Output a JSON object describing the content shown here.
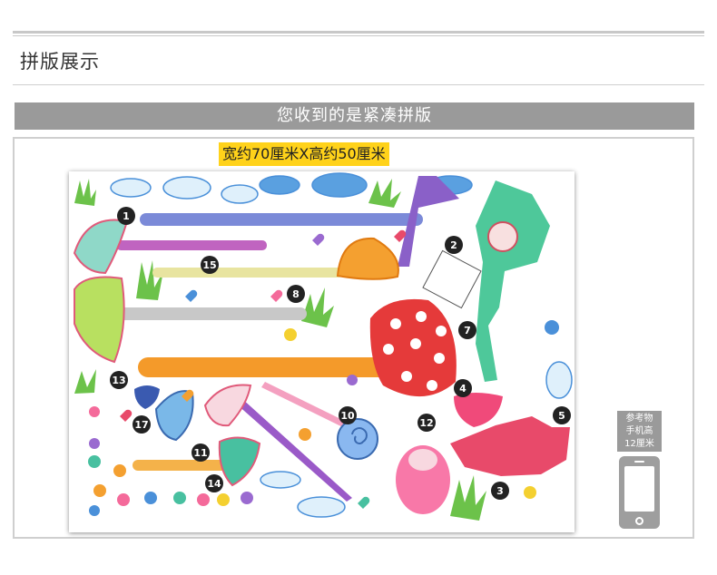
{
  "section": {
    "title": "拼版展示"
  },
  "banner": {
    "text": "您收到的是紧凑拼版"
  },
  "size": {
    "label": "宽约70厘米X高约50厘米"
  },
  "reference": {
    "line1": "参考物",
    "line2": "手机高",
    "line3": "12厘米",
    "icon": "phone-icon"
  },
  "markers": [
    "1",
    "2",
    "3",
    "4",
    "5",
    "7",
    "8",
    "10",
    "11",
    "12",
    "13",
    "14",
    "15",
    "17"
  ],
  "colors": {
    "banner": "#9a9a9a",
    "size_label": "#ffd21a",
    "marker": "#222222"
  }
}
